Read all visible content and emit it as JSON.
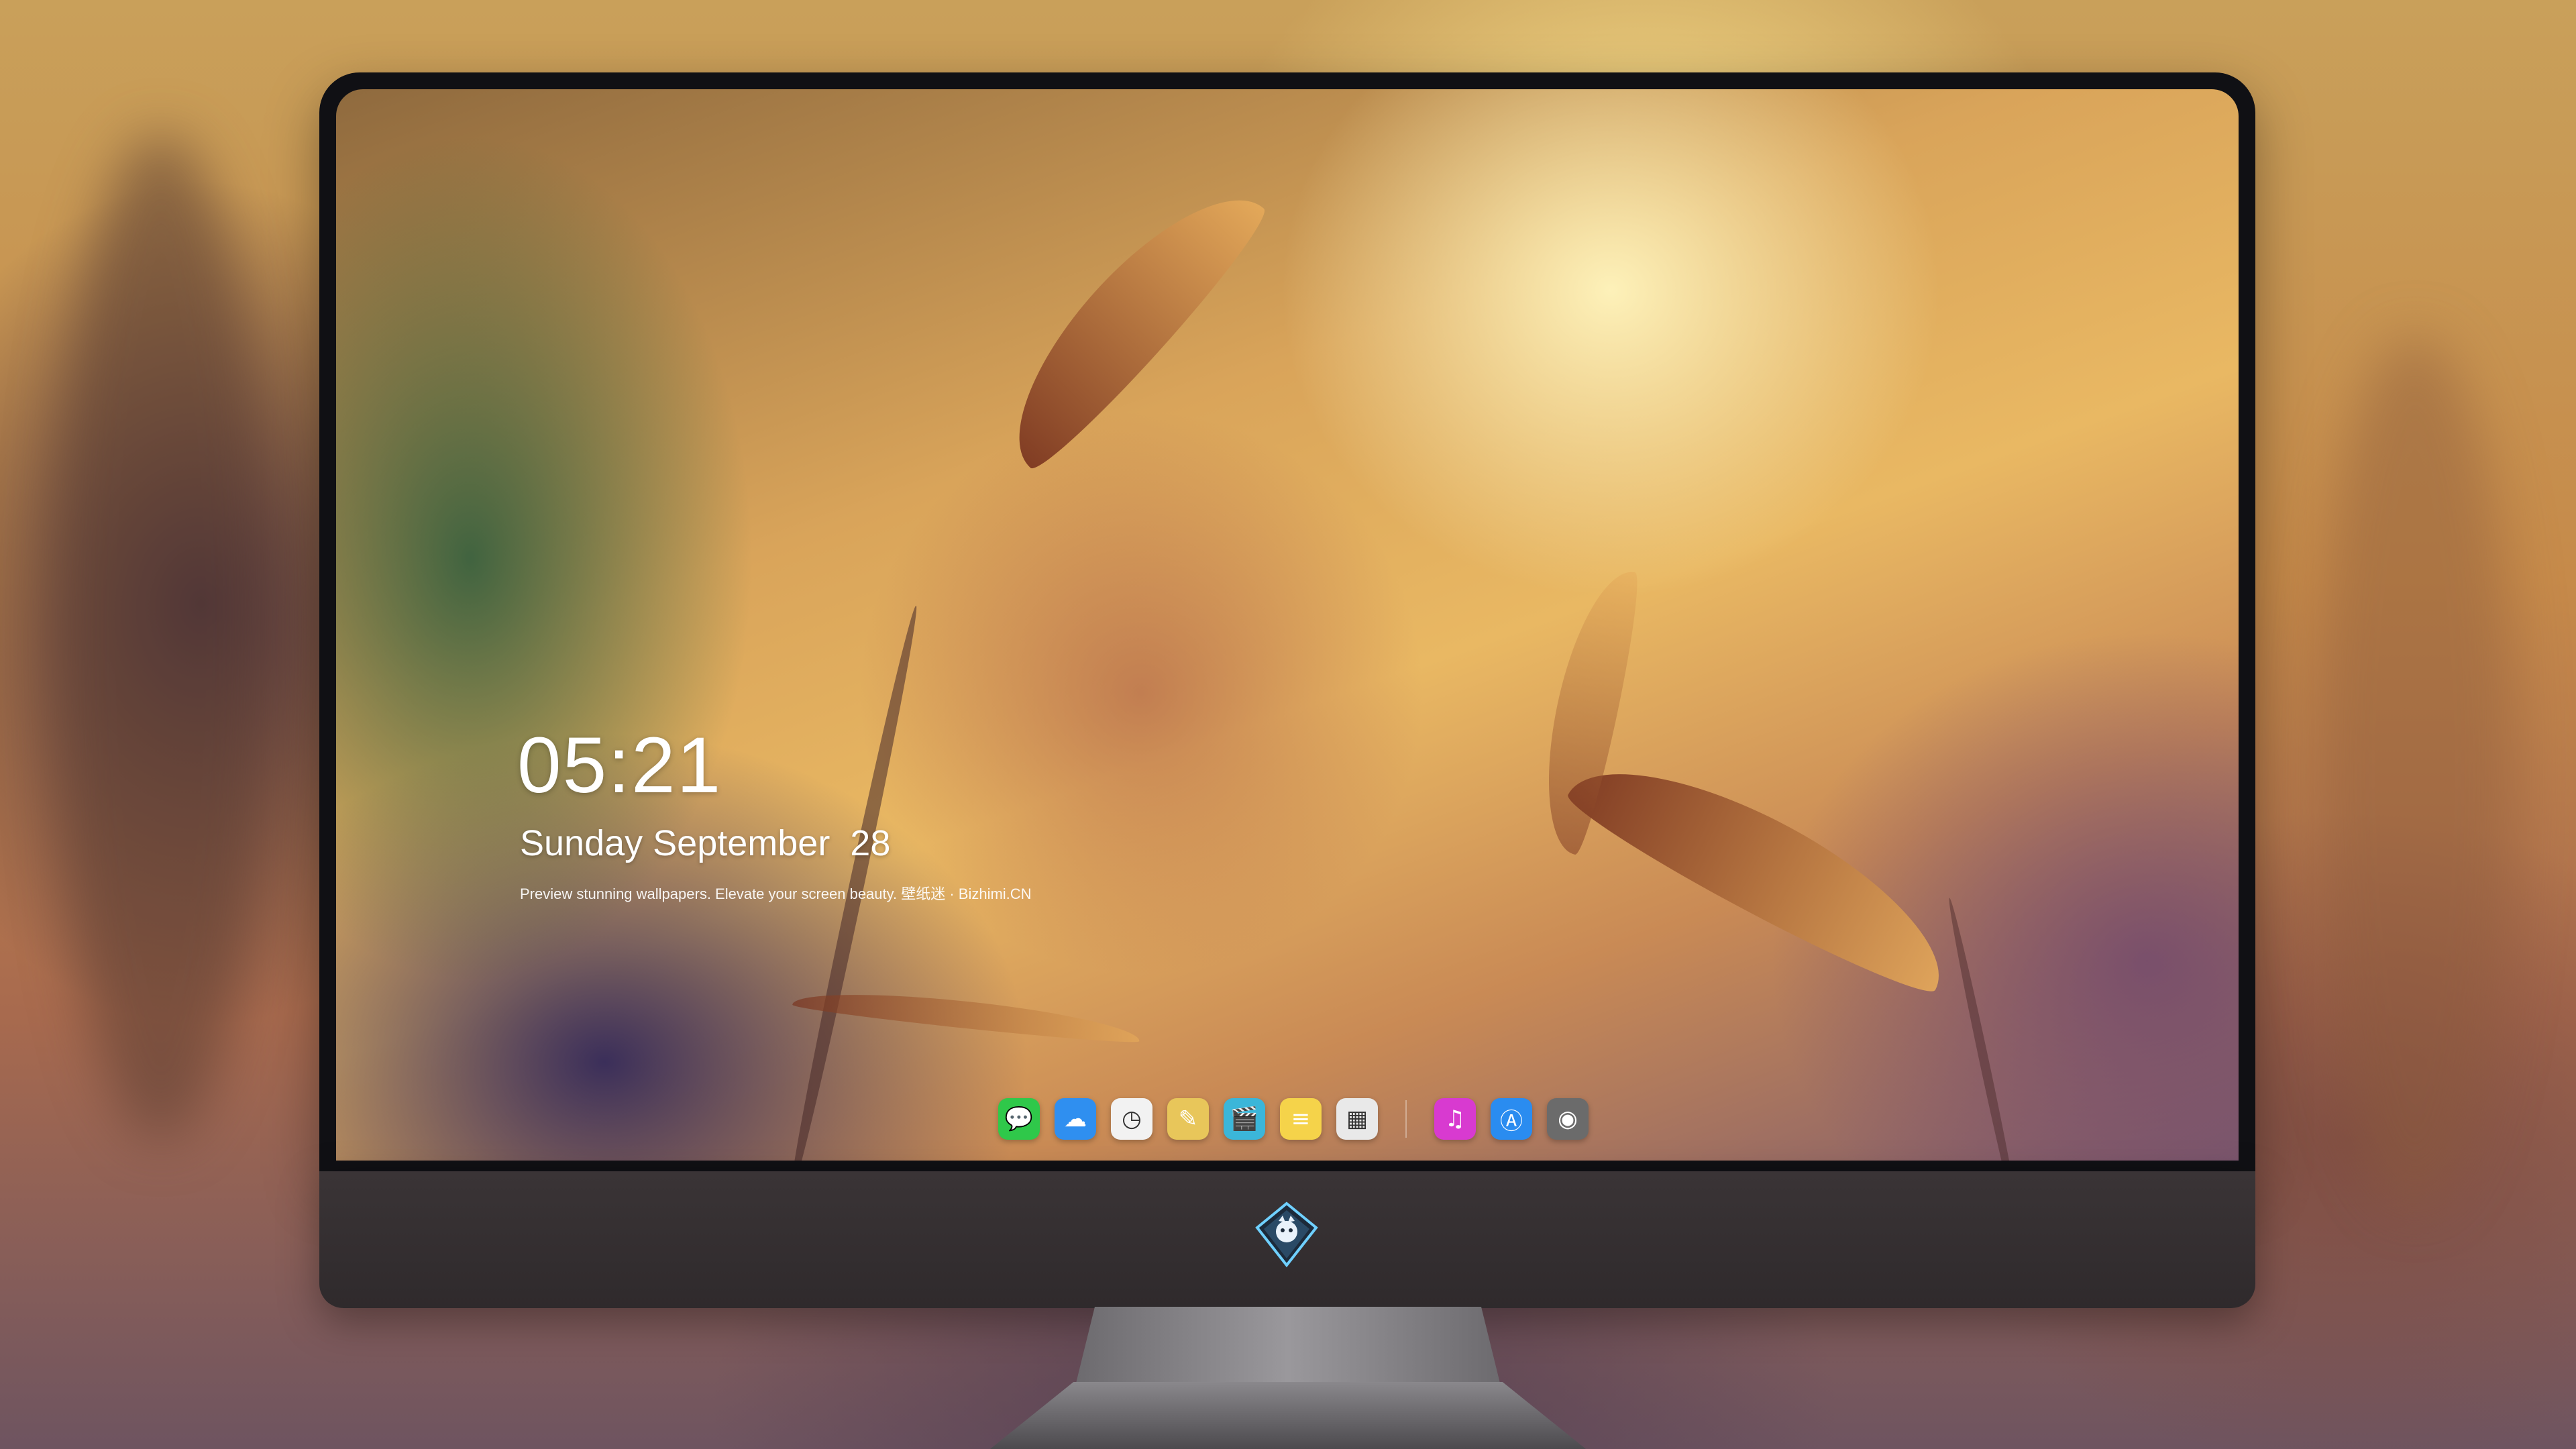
{
  "lockscreen": {
    "time": "05:21",
    "date": "Sunday September  28",
    "tagline": "Preview stunning wallpapers. Elevate your screen beauty. 壁纸迷 · Bizhimi.CN"
  },
  "dock": {
    "items": [
      {
        "name": "messages-icon",
        "glyph": "💬",
        "color": "#2fc84a"
      },
      {
        "name": "weather-icon",
        "glyph": "☁",
        "color": "#2f8ff0"
      },
      {
        "name": "clock-icon",
        "glyph": "◷",
        "color": "#f2f2f2"
      },
      {
        "name": "preview-icon",
        "glyph": "✎",
        "color": "#e8c65a"
      },
      {
        "name": "video-icon",
        "glyph": "🎬",
        "color": "#3bb6d9"
      },
      {
        "name": "notes-icon",
        "glyph": "≡",
        "color": "#f5d34a"
      },
      {
        "name": "photo-gallery-icon",
        "glyph": "▦",
        "color": "#e9e9e9"
      }
    ],
    "right_items": [
      {
        "name": "music-icon",
        "glyph": "♫",
        "color": "#d83ad0"
      },
      {
        "name": "app-store-icon",
        "glyph": "Ⓐ",
        "color": "#2a8cf0"
      },
      {
        "name": "camera-icon",
        "glyph": "◉",
        "color": "#6b6b6b"
      }
    ]
  },
  "monitor": {
    "logo": "dragon-emblem-icon"
  }
}
